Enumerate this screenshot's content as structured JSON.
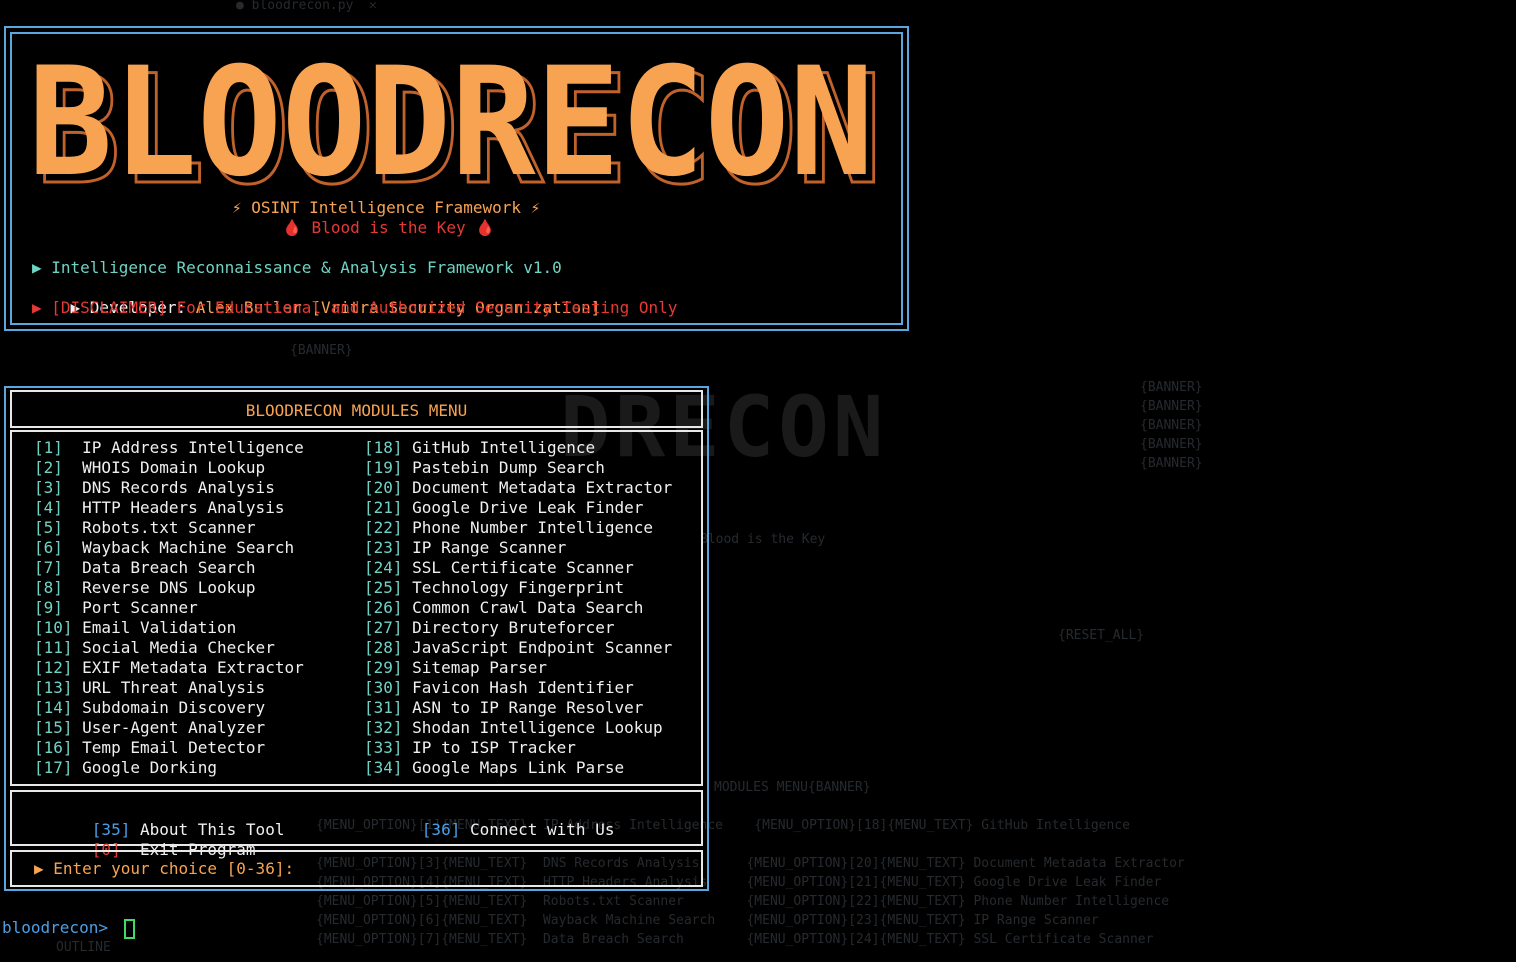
{
  "banner": {
    "logo_text": "BLOODRECON",
    "subtitle": "⚡ OSINT Intelligence Framework ⚡",
    "tagline": "🩸 Blood is the Key 🩸",
    "info_line": "▶ Intelligence Reconnaissance & Analysis Framework v1.0",
    "developer_prefix": "▶ Developer: ",
    "developer_name": "Alex Butler [Vritra Security Organization]",
    "disclaimer": "▶ [DISCLAIMER] For Educational and Authorized Security Testing Only"
  },
  "menu": {
    "title": "BLOODRECON MODULES MENU",
    "left": [
      {
        "num": "[1] ",
        "label": " IP Address Intelligence"
      },
      {
        "num": "[2] ",
        "label": " WHOIS Domain Lookup"
      },
      {
        "num": "[3] ",
        "label": " DNS Records Analysis"
      },
      {
        "num": "[4] ",
        "label": " HTTP Headers Analysis"
      },
      {
        "num": "[5] ",
        "label": " Robots.txt Scanner"
      },
      {
        "num": "[6] ",
        "label": " Wayback Machine Search"
      },
      {
        "num": "[7] ",
        "label": " Data Breach Search"
      },
      {
        "num": "[8] ",
        "label": " Reverse DNS Lookup"
      },
      {
        "num": "[9] ",
        "label": " Port Scanner"
      },
      {
        "num": "[10]",
        "label": " Email Validation"
      },
      {
        "num": "[11]",
        "label": " Social Media Checker"
      },
      {
        "num": "[12]",
        "label": " EXIF Metadata Extractor"
      },
      {
        "num": "[13]",
        "label": " URL Threat Analysis"
      },
      {
        "num": "[14]",
        "label": " Subdomain Discovery"
      },
      {
        "num": "[15]",
        "label": " User-Agent Analyzer"
      },
      {
        "num": "[16]",
        "label": " Temp Email Detector"
      },
      {
        "num": "[17]",
        "label": " Google Dorking"
      }
    ],
    "right": [
      {
        "num": "[18]",
        "label": " GitHub Intelligence"
      },
      {
        "num": "[19]",
        "label": " Pastebin Dump Search"
      },
      {
        "num": "[20]",
        "label": " Document Metadata Extractor"
      },
      {
        "num": "[21]",
        "label": " Google Drive Leak Finder"
      },
      {
        "num": "[22]",
        "label": " Phone Number Intelligence"
      },
      {
        "num": "[23]",
        "label": " IP Range Scanner"
      },
      {
        "num": "[24]",
        "label": " SSL Certificate Scanner"
      },
      {
        "num": "[25]",
        "label": " Technology Fingerprint"
      },
      {
        "num": "[26]",
        "label": " Common Crawl Data Search"
      },
      {
        "num": "[27]",
        "label": " Directory Bruteforcer"
      },
      {
        "num": "[28]",
        "label": " JavaScript Endpoint Scanner"
      },
      {
        "num": "[29]",
        "label": " Sitemap Parser"
      },
      {
        "num": "[30]",
        "label": " Favicon Hash Identifier"
      },
      {
        "num": "[31]",
        "label": " ASN to IP Range Resolver"
      },
      {
        "num": "[32]",
        "label": " Shodan Intelligence Lookup"
      },
      {
        "num": "[33]",
        "label": " IP to ISP Tracker"
      },
      {
        "num": "[34]",
        "label": " Google Maps Link Parse"
      }
    ],
    "about": {
      "num": "[35]",
      "label": " About This Tool"
    },
    "connect": {
      "num": "[36]",
      "label": " Connect with Us"
    },
    "exit": {
      "num": "[0]",
      "label": "  Exit Program"
    },
    "choice_prompt": "▶ Enter your choice [0-36]:"
  },
  "shell": {
    "prompt": "bloodrecon> "
  },
  "background_ghost": {
    "tab_title": "● bloodrecon.py  ✕",
    "code_lines": [
      "{BANNER}",
      "{BANNER}",
      "{BANNER}",
      "{BANNER}",
      "{BANNER}",
      "{BANNER}",
      "Blood is the Key",
      "{RESET_ALL}",
      "MODULES MENU{BANNER}",
      "{MENU_OPTION}[1]{MENU_TEXT}  IP Address Intelligence    {MENU_OPTION}[18]{MENU_TEXT} GitHub Intelligence",
      "{MENU_OPTION}[3]{MENU_TEXT}  DNS Records Analysis      {MENU_OPTION}[20]{MENU_TEXT} Document Metadata Extractor",
      "{MENU_OPTION}[4]{MENU_TEXT}  HTTP Headers Analysis     {MENU_OPTION}[21]{MENU_TEXT} Google Drive Leak Finder",
      "{MENU_OPTION}[5]{MENU_TEXT}  Robots.txt Scanner        {MENU_OPTION}[22]{MENU_TEXT} Phone Number Intelligence",
      "{MENU_OPTION}[6]{MENU_TEXT}  Wayback Machine Search    {MENU_OPTION}[23]{MENU_TEXT} IP Range Scanner",
      "{MENU_OPTION}[7]{MENU_TEXT}  Data Breach Search        {MENU_OPTION}[24]{MENU_TEXT} SSL Certificate Scanner",
      "OUTLINE"
    ]
  },
  "colors": {
    "logo_fill": "#f8a352",
    "logo_shadow": "#c2622b",
    "border_blue": "#5aa7e0",
    "accent_teal": "#6fd3c4",
    "red": "#e53935",
    "cursor_green": "#3ddc64"
  }
}
